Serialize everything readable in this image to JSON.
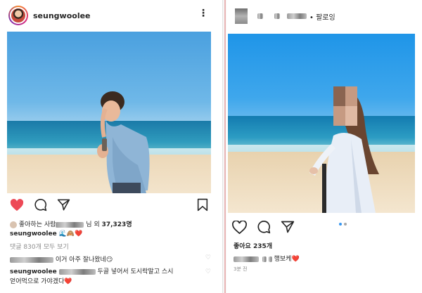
{
  "left_post": {
    "username": "seungwoolee",
    "more_icon": "more-vertical-icon",
    "actions": [
      "heart-filled-icon",
      "comment-icon",
      "share-icon",
      "bookmark-icon"
    ],
    "likes_prefix": "좋아하는 사람",
    "likes_mid": "님 외",
    "likes_count": "37,323명",
    "caption_user": "seungwoolee",
    "caption_emoji": "🌊🙈❤️",
    "view_comments": "댓글 830개 모두 보기",
    "comment1_text": "이거 아주 잘나왔네😏",
    "comment2_user": "seungwoolee",
    "comment2_text_a": "두골 넣어서 도시락말고 스시",
    "comment2_text_b": "얻어먹으로 가야겠다❤️"
  },
  "right_post": {
    "follow_label": "• 팔로잉",
    "actions": [
      "heart-outline-icon",
      "comment-icon",
      "share-icon"
    ],
    "likes": "좋아요 235개",
    "caption_text": "행보케",
    "caption_heart": "❤️",
    "time": "3분 전",
    "carousel_dots": 2,
    "active_dot": 0
  },
  "colors": {
    "like_red": "#ed4956",
    "link_blue": "#3897f0",
    "text": "#262626",
    "muted": "#8e8e8e"
  }
}
